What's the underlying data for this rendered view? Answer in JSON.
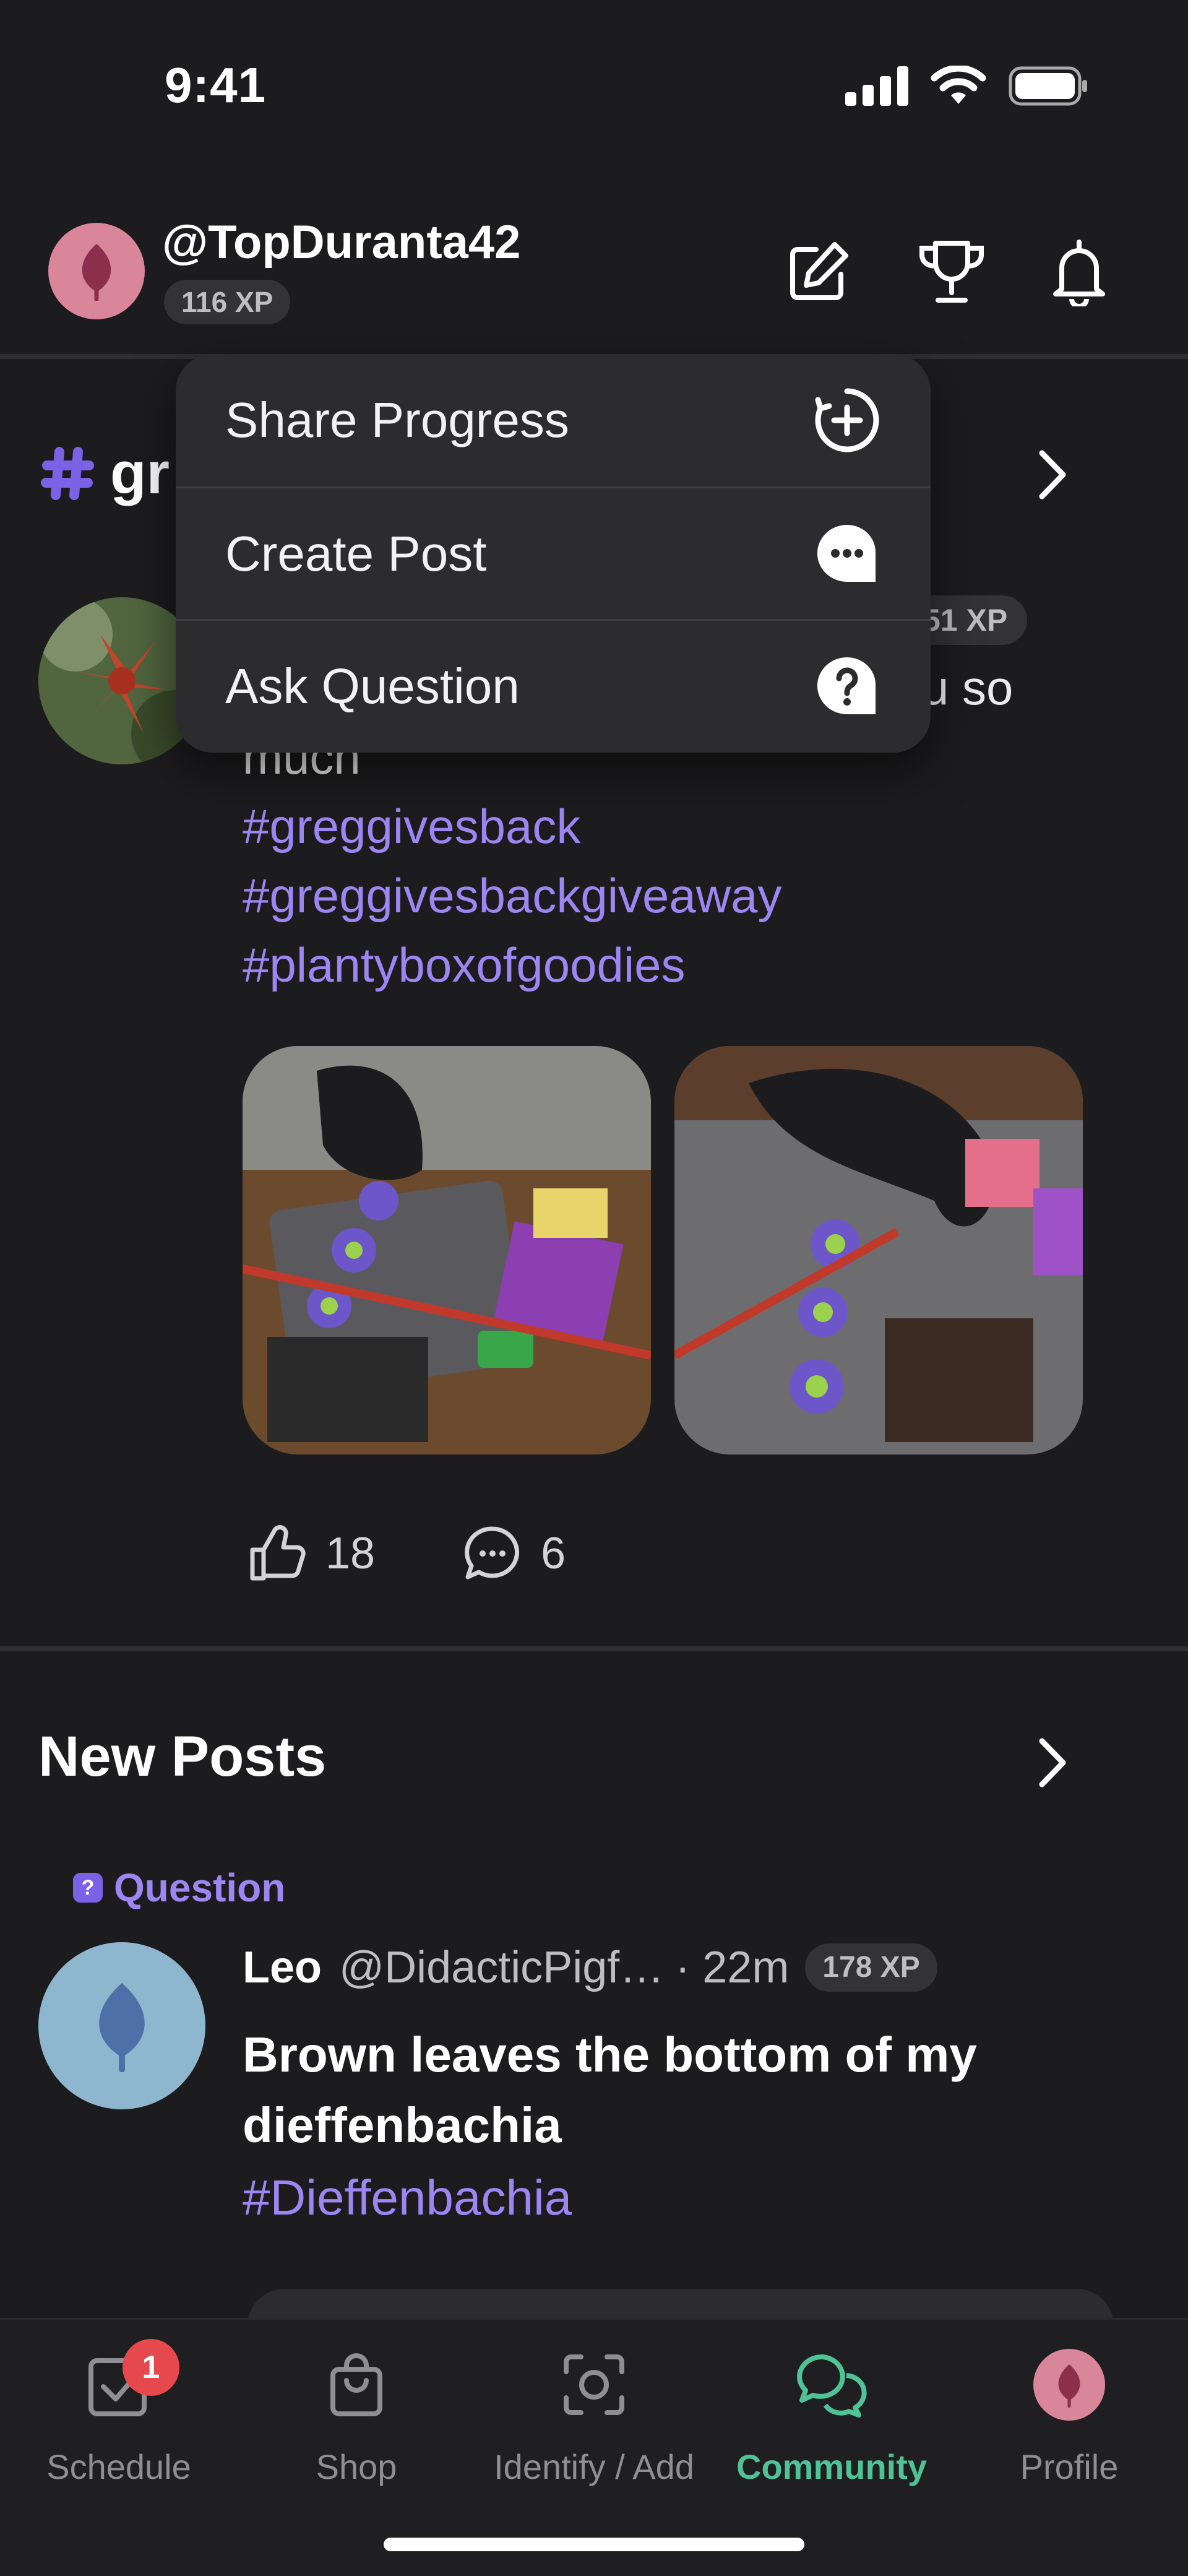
{
  "status_bar": {
    "time": "9:41"
  },
  "header": {
    "username": "@TopDuranta42",
    "xp": "116 XP"
  },
  "featured": {
    "tag": "gr",
    "post": {
      "author_xp": "51 XP",
      "text_line1_tail": "u so",
      "text_line2": "much",
      "hashtags": [
        "#greggivesback",
        "#greggivesbackgiveaway",
        "#plantyboxofgoodies"
      ],
      "likes": "18",
      "comments": "6"
    }
  },
  "new_posts": {
    "title": "New Posts",
    "item": {
      "badge": "Question",
      "badge_icon": "?",
      "name": "Leo",
      "handle": "@DidacticPigf…",
      "time": "· 22m",
      "xp": "178 XP",
      "title": "Brown leaves the bottom of my dieffenbachia",
      "hashtag": "#Dieffenbachia"
    }
  },
  "menu": {
    "items": [
      {
        "label": "Share Progress",
        "icon": "plus-circle-icon"
      },
      {
        "label": "Create Post",
        "icon": "chat-bubble-icon"
      },
      {
        "label": "Ask Question",
        "icon": "question-bubble-icon"
      }
    ]
  },
  "tabbar": {
    "tabs": [
      {
        "label": "Schedule",
        "badge": "1"
      },
      {
        "label": "Shop"
      },
      {
        "label": "Identify / Add"
      },
      {
        "label": "Community",
        "active": true
      },
      {
        "label": "Profile"
      }
    ]
  },
  "colors": {
    "accent": "#4fc397",
    "hashtag": "#9b86f2",
    "badge": "#e5484d"
  }
}
